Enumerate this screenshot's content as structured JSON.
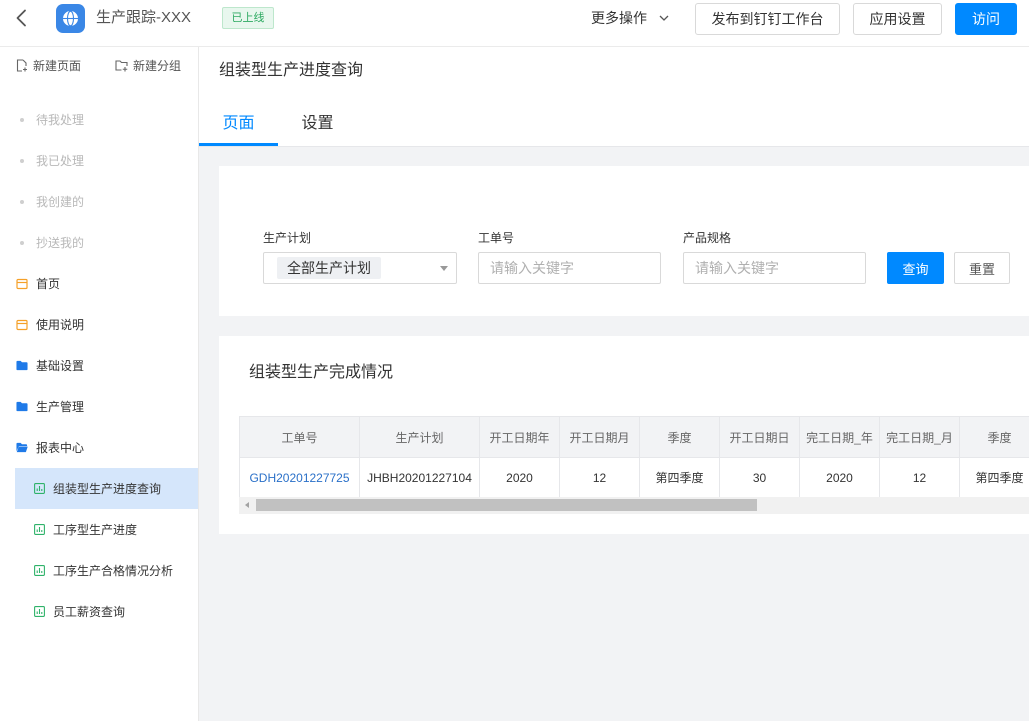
{
  "theme": {
    "primary": "#0089ff",
    "page_bg": "#f2f3f5",
    "app_icon_blue": "#3a87e6",
    "badge_green": "#2eaa62",
    "active_nav_bg": "#d5e6fb",
    "folder_blue": "#1f7ae8",
    "page_icon_orange": "#f5a028",
    "report_icon_green": "#2fb26a",
    "link_blue": "#2a70c8"
  },
  "header": {
    "back_icon": "chevron-left-icon",
    "app_icon": "globe-icon",
    "app_title": "生产跟踪-XXX",
    "status_badge": "已上线",
    "more_actions": "更多操作",
    "more_actions_icon": "chevron-down-icon",
    "publish_button": "发布到钉钉工作台",
    "app_settings_button": "应用设置",
    "visit_button": "访问"
  },
  "sidebar": {
    "new_page": {
      "label": "新建页面",
      "icon": "add-page-icon"
    },
    "new_group": {
      "label": "新建分组",
      "icon": "add-folder-icon"
    },
    "system_items": [
      {
        "label": "待我处理"
      },
      {
        "label": "我已处理"
      },
      {
        "label": "我创建的"
      },
      {
        "label": "抄送我的"
      }
    ],
    "items": [
      {
        "label": "首页",
        "icon": "page-icon"
      },
      {
        "label": "使用说明",
        "icon": "page-icon"
      },
      {
        "label": "基础设置",
        "icon": "folder-icon"
      },
      {
        "label": "生产管理",
        "icon": "folder-icon"
      },
      {
        "label": "报表中心",
        "icon": "folder-open-icon",
        "expanded": true
      }
    ],
    "report_pages": [
      {
        "label": "组装型生产进度查询",
        "icon": "report-icon",
        "active": true
      },
      {
        "label": "工序型生产进度",
        "icon": "report-icon",
        "active": false
      },
      {
        "label": "工序生产合格情况分析",
        "icon": "report-icon",
        "active": false
      },
      {
        "label": "员工薪资查询",
        "icon": "report-icon",
        "active": false
      }
    ]
  },
  "page": {
    "title": "组装型生产进度查询",
    "tabs": [
      {
        "label": "页面",
        "active": true
      },
      {
        "label": "设置",
        "active": false
      }
    ]
  },
  "filters": {
    "plan": {
      "label": "生产计划",
      "selected": "全部生产计划",
      "icon": "caret-down-icon"
    },
    "order_no": {
      "label": "工单号",
      "value": "",
      "placeholder": "请输入关键字"
    },
    "spec": {
      "label": "产品规格",
      "value": "",
      "placeholder": "请输入关键字"
    },
    "query_button": "查询",
    "reset_button": "重置"
  },
  "report": {
    "title": "组装型生产完成情况",
    "columns": [
      "工单号",
      "生产计划",
      "开工日期年",
      "开工日期月",
      "季度",
      "开工日期日",
      "完工日期_年",
      "完工日期_月",
      "季度"
    ],
    "rows": [
      [
        "GDH20201227725",
        "JHBH20201227104",
        "2020",
        "12",
        "第四季度",
        "30",
        "2020",
        "12",
        "第四季度"
      ]
    ]
  }
}
